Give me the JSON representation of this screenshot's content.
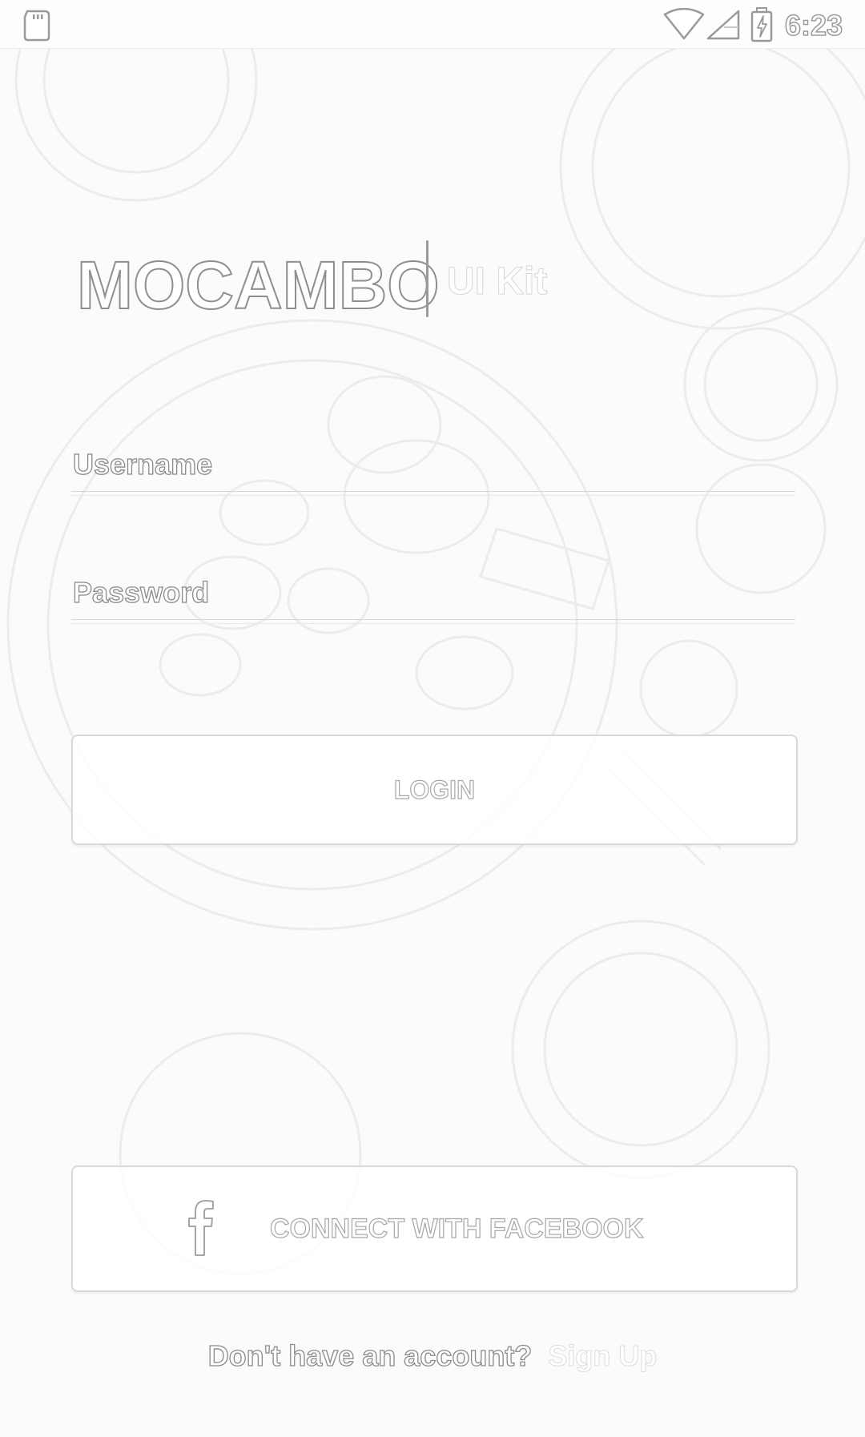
{
  "status_bar": {
    "time": "6:23",
    "icons": [
      "sd-card-icon",
      "wifi-icon",
      "cell-signal-icon",
      "battery-charging-icon"
    ]
  },
  "logo": {
    "title": "MOCAMBO",
    "subtitle": "UI Kit"
  },
  "form": {
    "username_placeholder": "Username",
    "password_placeholder": "Password",
    "username_value": "",
    "password_value": ""
  },
  "buttons": {
    "login_label": "LOGIN",
    "facebook_label": "CONNECT WITH FACEBOOK",
    "facebook_icon": "facebook-icon"
  },
  "footer": {
    "prompt": "Don't have an account?",
    "signup_link": "Sign Up"
  },
  "colors": {
    "background": "#fbfbfb",
    "outline_text": "#8a8a8a",
    "button_border": "#d9d9d9"
  }
}
